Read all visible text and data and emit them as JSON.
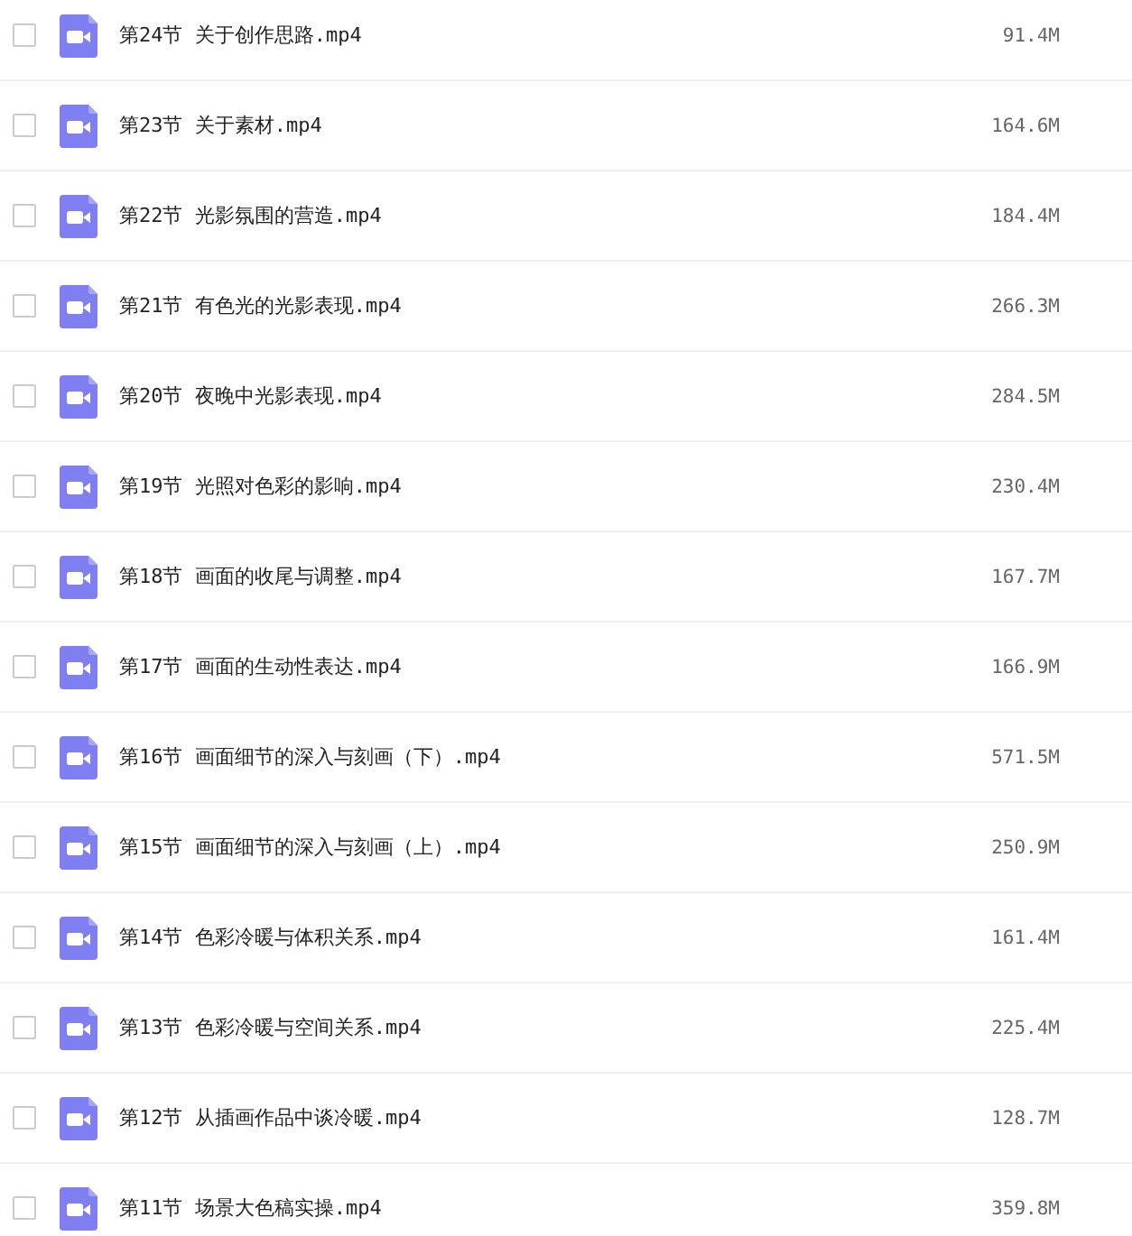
{
  "files": [
    {
      "name": "第24节 关于创作思路.mp4",
      "size": "91.4M",
      "checked": false
    },
    {
      "name": "第23节 关于素材.mp4",
      "size": "164.6M",
      "checked": false
    },
    {
      "name": "第22节 光影氛围的营造.mp4",
      "size": "184.4M",
      "checked": false
    },
    {
      "name": "第21节 有色光的光影表现.mp4",
      "size": "266.3M",
      "checked": false
    },
    {
      "name": "第20节 夜晚中光影表现.mp4",
      "size": "284.5M",
      "checked": false
    },
    {
      "name": "第19节 光照对色彩的影响.mp4",
      "size": "230.4M",
      "checked": false
    },
    {
      "name": "第18节 画面的收尾与调整.mp4",
      "size": "167.7M",
      "checked": false
    },
    {
      "name": "第17节 画面的生动性表达.mp4",
      "size": "166.9M",
      "checked": false
    },
    {
      "name": "第16节 画面细节的深入与刻画（下）.mp4",
      "size": "571.5M",
      "checked": false
    },
    {
      "name": "第15节 画面细节的深入与刻画（上）.mp4",
      "size": "250.9M",
      "checked": false
    },
    {
      "name": "第14节 色彩冷暖与体积关系.mp4",
      "size": "161.4M",
      "checked": false
    },
    {
      "name": "第13节 色彩冷暖与空间关系.mp4",
      "size": "225.4M",
      "checked": false
    },
    {
      "name": "第12节 从插画作品中谈冷暖.mp4",
      "size": "128.7M",
      "checked": false
    },
    {
      "name": "第11节 场景大色稿实操.mp4",
      "size": "359.8M",
      "checked": false
    }
  ]
}
